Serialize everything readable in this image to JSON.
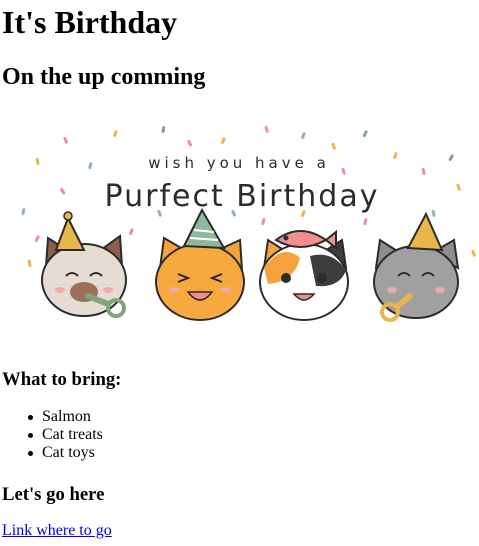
{
  "page": {
    "title": "It's Birthday",
    "subtitle": "On the up comming"
  },
  "banner": {
    "tagline": "wish you have a",
    "headline": "Purfect Birthday",
    "cats": [
      {
        "name": "cream-cat",
        "hat_color": "#e8b64a",
        "blower_color": "#7fa67a"
      },
      {
        "name": "orange-cat",
        "hat_color": "#8fb89a",
        "blower_color": null
      },
      {
        "name": "calico-cat",
        "hat_color": null,
        "hat_item": "fish-hat",
        "blower_color": null
      },
      {
        "name": "gray-cat",
        "hat_color": "#e8b64a",
        "blower_color": "#e8b64a"
      }
    ],
    "confetti_colors": [
      "#e8b64a",
      "#8fb89a",
      "#ef8f8f",
      "#7fa67a"
    ]
  },
  "bring": {
    "heading": "What to bring:",
    "items": [
      "Salmon",
      "Cat treats",
      "Cat toys"
    ]
  },
  "location": {
    "heading": "Let's go here",
    "link_text": "Link where to go"
  },
  "colors": {
    "text": "#000000",
    "link": "#0000ee",
    "background": "#ffffff"
  }
}
